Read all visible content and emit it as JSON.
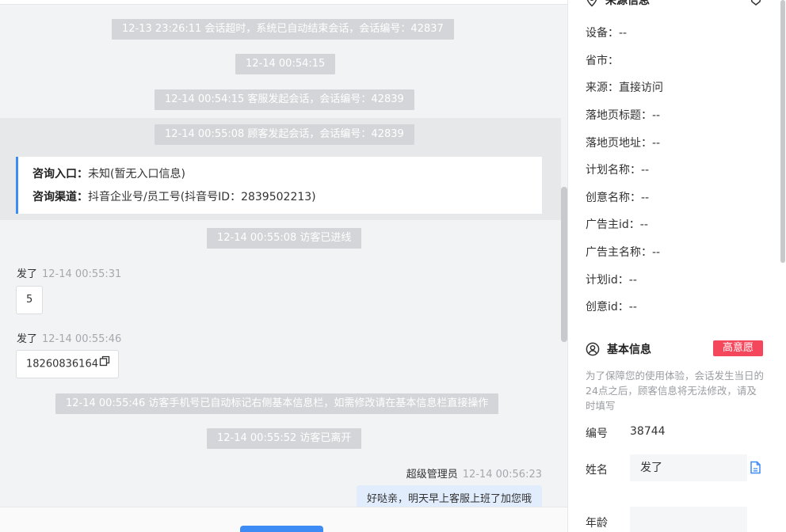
{
  "chat": {
    "sys_messages": [
      "12-13 23:26:11 会话超时，系统已自动结束会话，会话编号：42837",
      "12-14 00:54:15",
      "12-14 00:54:15 客服发起会话，会话编号：42839",
      "12-14 00:55:08 顾客发起会话，会话编号：42839",
      "12-14 00:55:08 访客已进线",
      "12-14 00:55:46 访客手机号已自动标记右侧基本信息栏，如需修改请在基本信息栏直接操作",
      "12-14 00:55:52 访客已离开"
    ],
    "entry": {
      "entry_label": "咨询入口：",
      "entry_value": "未知(暂无入口信息)",
      "channel_label": "咨询渠道：",
      "channel_value": "抖音企业号/员工号(抖音号ID：2839502213)"
    },
    "visitor_messages": [
      {
        "sender": "发了",
        "time": "12-14 00:55:31",
        "text": "5"
      },
      {
        "sender": "发了",
        "time": "12-14 00:55:46",
        "text": "18260836164"
      }
    ],
    "agent_message": {
      "sender": "超级管理员",
      "time": "12-14 00:56:23",
      "text": "好哒亲，明天早上客服上班了加您哦"
    }
  },
  "panel": {
    "source": {
      "title": "来源信息",
      "rows": [
        "设备：--",
        "省市：",
        "来源：直接访问",
        "落地页标题：--",
        "落地页地址：--",
        "计划名称：--",
        "创意名称：--",
        "广告主id：--",
        "广告主名称：--",
        "计划id：--",
        "创意id：--"
      ]
    },
    "basic": {
      "title": "基本信息",
      "badge": "高意愿",
      "notice": "为了保障您的使用体验，会话发生当日的24点之后，顾客信息将无法修改，请及时填写",
      "id_label": "编号",
      "id_value": "38744",
      "name_label": "姓名",
      "name_value": "发了",
      "age_label": "年龄",
      "age_value": ""
    }
  },
  "colors": {
    "accent": "#3d8bf5",
    "badge": "#f5475c",
    "agent_bubble": "#e1edfd"
  }
}
